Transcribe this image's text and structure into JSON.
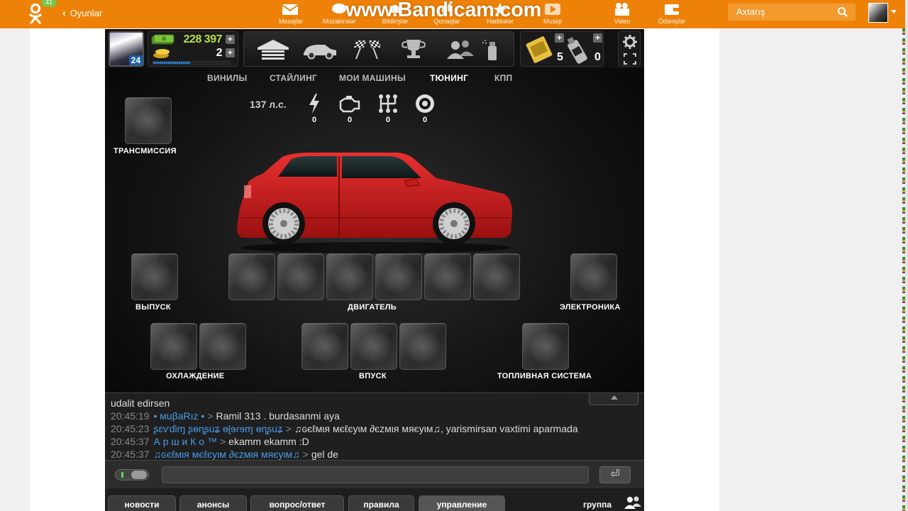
{
  "topbar": {
    "badge": "41",
    "back_label": "Oyunlar",
    "nav": [
      {
        "label": "Mesajlar",
        "icon": "envelope-icon"
      },
      {
        "label": "Müzakirələr",
        "icon": "chat-bubble-icon"
      },
      {
        "label": "Bildirişlər",
        "icon": "bell-icon"
      },
      {
        "label": "Qonaqlar",
        "icon": "footprints-icon"
      },
      {
        "label": "Hadisələr",
        "icon": "star-icon"
      },
      {
        "label": "Musiqi",
        "icon": "play-icon"
      },
      {
        "label": "Video",
        "icon": "film-camera-icon"
      },
      {
        "label": "Ödənişlər",
        "icon": "wallet-icon"
      }
    ],
    "watermark": "www.Bandicam.com",
    "search_placeholder": "Axtarış"
  },
  "hud": {
    "level": "24",
    "money": "228 397",
    "gold": "2",
    "xp_progress": 0.48,
    "tickets": "5",
    "nitro": "0"
  },
  "tabs": [
    {
      "label": "ВИНИЛЫ",
      "active": false
    },
    {
      "label": "СТАЙЛИНГ",
      "active": false
    },
    {
      "label": "МОИ МАШИНЫ",
      "active": false
    },
    {
      "label": "ТЮНИНГ",
      "active": true
    },
    {
      "label": "КПП",
      "active": false
    }
  ],
  "stats": {
    "hp": "137 л.с.",
    "values": [
      "0",
      "0",
      "0",
      "0"
    ]
  },
  "groups": {
    "transmission": "ТРАНСМИССИЯ",
    "exhaust": "ВЫПУСК",
    "engine": "ДВИГАТЕЛЬ",
    "electronics": "ЭЛЕКТРОНИКА",
    "cooling": "ОХЛАЖДЕНИЕ",
    "intake": "ВПУСК",
    "fuel": "ТОПЛИВНАЯ СИСТЕМА"
  },
  "colors": {
    "brand_orange": "#ee8208",
    "money_green": "#b8e04a",
    "chat_user_blue": "#4a9be8",
    "car_red": "#d42020"
  },
  "chat": {
    "partial_line": "udalit edirsen",
    "messages": [
      {
        "time": "20:45:19",
        "user": "• мuβaRız •",
        "to": "Ramil 313",
        "text": ". burdasanmi  aya"
      },
      {
        "time": "20:45:23",
        "user": "ʂɛѵɗiɱ ʂɵɳʂuʑ ɵɭɘɾɘɱ ɵɳʂuʑ",
        "to": "♫ɢєℓмιя мєℓєуιм ∂єzмιя мяєуιм♫",
        "text": ", yarismirsan vaxtimi aparmada"
      },
      {
        "time": "20:45:37",
        "user": "А р ш и К о ™",
        "to": "",
        "text": "ekamm ekamm :D"
      },
      {
        "time": "20:45:37",
        "user": "♫ɢєℓмιя мєℓєуιм ∂єzмιя мяєуιм♫",
        "to": "",
        "text": "gel de"
      }
    ],
    "input_value": ""
  },
  "bottom_tabs": [
    {
      "label": "новости",
      "active": false
    },
    {
      "label": "анонсы",
      "active": false
    },
    {
      "label": "вопрос/ответ",
      "active": false
    },
    {
      "label": "правила",
      "active": false
    },
    {
      "label": "управление",
      "active": true
    }
  ],
  "group_link": "группа"
}
